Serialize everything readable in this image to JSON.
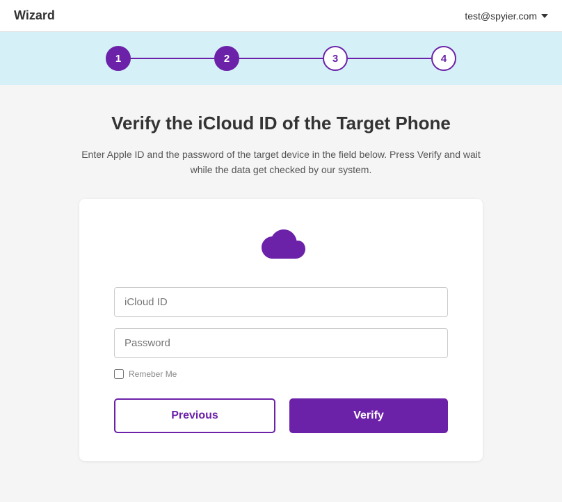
{
  "header": {
    "title": "Wizard",
    "user_email": "test@spyier.com"
  },
  "stepper": {
    "steps": [
      {
        "number": "1",
        "state": "active"
      },
      {
        "number": "2",
        "state": "active"
      },
      {
        "number": "3",
        "state": "inactive"
      },
      {
        "number": "4",
        "state": "inactive"
      }
    ]
  },
  "main": {
    "title": "Verify the iCloud ID of the Target Phone",
    "description": "Enter Apple ID and the password of the target device in the field below. Press Verify and wait while the data get checked by our system.",
    "icloud_id_placeholder": "iCloud ID",
    "password_placeholder": "Password",
    "remember_me_label": "Remeber Me",
    "previous_label": "Previous",
    "verify_label": "Verify"
  }
}
